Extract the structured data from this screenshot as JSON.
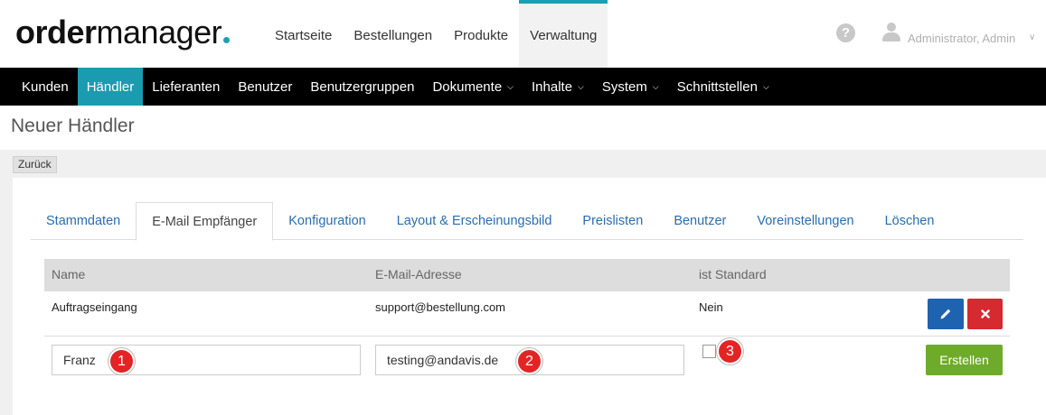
{
  "logo": {
    "part_bold": "order",
    "part_light": "manager"
  },
  "top_nav": [
    {
      "label": "Startseite"
    },
    {
      "label": "Bestellungen"
    },
    {
      "label": "Produkte"
    },
    {
      "label": "Verwaltung",
      "active": true
    }
  ],
  "user": {
    "name": "Administrator, Admin"
  },
  "sub_nav": [
    {
      "label": "Kunden"
    },
    {
      "label": "Händler",
      "active": true
    },
    {
      "label": "Lieferanten"
    },
    {
      "label": "Benutzer"
    },
    {
      "label": "Benutzergruppen"
    },
    {
      "label": "Dokumente",
      "dropdown": true
    },
    {
      "label": "Inhalte",
      "dropdown": true
    },
    {
      "label": "System",
      "dropdown": true
    },
    {
      "label": "Schnittstellen",
      "dropdown": true
    }
  ],
  "page": {
    "title": "Neuer Händler",
    "back_label": "Zurück"
  },
  "tabs": [
    {
      "label": "Stammdaten"
    },
    {
      "label": "E-Mail Empfänger",
      "active": true
    },
    {
      "label": "Konfiguration"
    },
    {
      "label": "Layout & Erscheinungsbild"
    },
    {
      "label": "Preislisten"
    },
    {
      "label": "Benutzer"
    },
    {
      "label": "Voreinstellungen"
    },
    {
      "label": "Löschen"
    }
  ],
  "table": {
    "headers": {
      "name": "Name",
      "email": "E-Mail-Adresse",
      "standard": "ist Standard"
    },
    "rows": [
      {
        "name": "Auftragseingang",
        "email": "support@bestellung.com",
        "standard": "Nein"
      }
    ],
    "new_row": {
      "name_value": "Franz",
      "email_value": "testing@andavis.de",
      "standard_checked": false,
      "create_label": "Erstellen"
    }
  },
  "annotations": [
    "1",
    "2",
    "3"
  ],
  "colors": {
    "accent": "#1aa0b4",
    "edit": "#1e63b0",
    "delete": "#d42a30",
    "create": "#6fab2a",
    "badge": "#e42424"
  }
}
